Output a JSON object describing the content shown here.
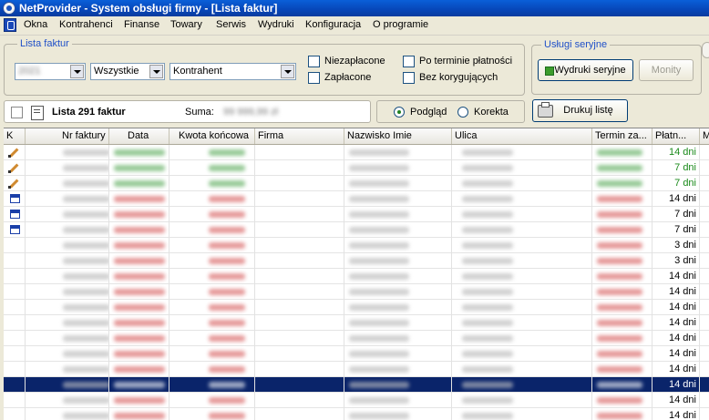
{
  "window": {
    "title": "NetProvider - System obsługi firmy - [Lista faktur]"
  },
  "menu": [
    "Okna",
    "Kontrahenci",
    "Finanse",
    "Towary",
    "Serwis",
    "Wydruki",
    "Konfiguracja",
    "O programie"
  ],
  "filters": {
    "group_label": "Lista faktur",
    "combo_year": "2021",
    "combo_status": "Wszystkie",
    "combo_contractor": "Kontrahent",
    "checks": {
      "niezaplacone": "Niezapłacone",
      "zaplacone": "Zapłacone",
      "po_terminie": "Po terminie płatności",
      "bez_korygujacych": "Bez korygujących"
    }
  },
  "services": {
    "group_label": "Usługi seryjne",
    "print_button": "Wydruki seryjne",
    "reminders_button": "Monity"
  },
  "summary": {
    "count_label": "Lista 291 faktur",
    "sum_label": "Suma:",
    "sum_value": "99 999,99 zł"
  },
  "view": {
    "podglad": "Podgląd",
    "korekta": "Korekta",
    "print_list": "Drukuj listę"
  },
  "colors": {
    "green": "#1a8a1a",
    "red": "#c82020",
    "selection": "#0a246a"
  },
  "table": {
    "columns": [
      "K",
      "Nr faktury",
      "Data",
      "Kwota końcowa",
      "Firma",
      "Nazwisko Imie",
      "Ulica",
      "Termin za...",
      "Płatn...",
      "M"
    ],
    "rows": [
      {
        "icon": "pencil-icon",
        "tone": "green",
        "days": "14 dni"
      },
      {
        "icon": "pencil-icon",
        "tone": "green",
        "days": "7 dni"
      },
      {
        "icon": "pencil-icon",
        "tone": "green",
        "days": "7 dni"
      },
      {
        "icon": "window-icon",
        "tone": "red",
        "days": "14 dni"
      },
      {
        "icon": "window-icon",
        "tone": "red",
        "days": "7 dni"
      },
      {
        "icon": "window-icon",
        "tone": "red",
        "days": "7 dni"
      },
      {
        "icon": "",
        "tone": "red",
        "days": "3 dni"
      },
      {
        "icon": "",
        "tone": "red",
        "days": "3 dni"
      },
      {
        "icon": "",
        "tone": "red",
        "days": "14 dni"
      },
      {
        "icon": "",
        "tone": "red",
        "days": "14 dni"
      },
      {
        "icon": "",
        "tone": "red",
        "days": "14 dni"
      },
      {
        "icon": "",
        "tone": "red",
        "days": "14 dni"
      },
      {
        "icon": "",
        "tone": "red",
        "days": "14 dni"
      },
      {
        "icon": "",
        "tone": "red",
        "days": "14 dni"
      },
      {
        "icon": "",
        "tone": "red",
        "days": "14 dni"
      },
      {
        "icon": "",
        "tone": "sel",
        "days": "14 dni"
      },
      {
        "icon": "",
        "tone": "red",
        "days": "14 dni"
      },
      {
        "icon": "",
        "tone": "red",
        "days": "14 dni"
      }
    ]
  }
}
